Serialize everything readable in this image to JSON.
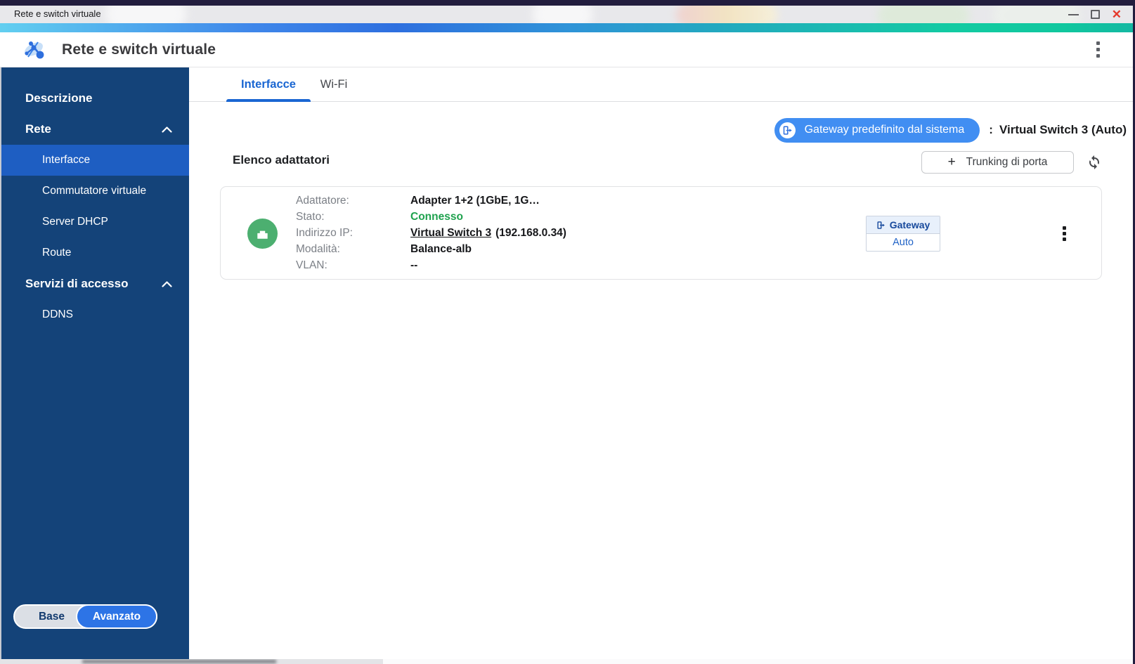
{
  "titlebar": {
    "title": "Rete e switch virtuale"
  },
  "header": {
    "title": "Rete e switch virtuale"
  },
  "sidebar": {
    "items": [
      {
        "label": "Descrizione",
        "type": "section",
        "selected": false
      },
      {
        "label": "Rete",
        "type": "section",
        "expanded": true,
        "selected": false
      },
      {
        "label": "Interfacce",
        "type": "child",
        "selected": true
      },
      {
        "label": "Commutatore virtuale",
        "type": "child",
        "selected": false
      },
      {
        "label": "Server DHCP",
        "type": "child",
        "selected": false
      },
      {
        "label": "Route",
        "type": "child",
        "selected": false
      },
      {
        "label": "Servizi di accesso",
        "type": "section",
        "expanded": true,
        "selected": false
      },
      {
        "label": "DDNS",
        "type": "child",
        "selected": false
      }
    ],
    "mode_toggle": {
      "base": "Base",
      "advanced": "Avanzato",
      "selected": "Avanzato"
    }
  },
  "main": {
    "tabs": [
      {
        "label": "Interfacce",
        "active": true
      },
      {
        "label": "Wi-Fi",
        "active": false
      }
    ],
    "default_gateway": {
      "button_label": "Gateway predefinito dal sistema",
      "separator": ":",
      "value": "Virtual Switch 3 (Auto)"
    },
    "adapter_list": {
      "heading": "Elenco adattatori",
      "trunking_button_label": "Trunking di porta",
      "adapters": [
        {
          "adapter_label": "Adattatore:",
          "adapter_value": "Adapter 1+2 (1GbE, 1G…",
          "status_label": "Stato:",
          "status_value": "Connesso",
          "ip_label": "Indirizzo IP:",
          "ip_link": "Virtual Switch 3",
          "ip_suffix": "(192.168.0.34)",
          "mode_label": "Modalità:",
          "mode_value": "Balance-alb",
          "vlan_label": "VLAN:",
          "vlan_value": "--",
          "badge": {
            "top": "Gateway",
            "bottom": "Auto"
          }
        }
      ]
    }
  },
  "icons": {
    "close": "✕",
    "plus": "+"
  },
  "colors": {
    "sidebar": "#144379",
    "sidebar_selected": "#1e5ec2",
    "accent_blue": "#1a66d2",
    "gateway_pill": "#418ef2",
    "status_connected": "#1fa24e",
    "gradient": [
      "#62cff0",
      "#2e6fdf",
      "#23a8c0",
      "#12cba2"
    ]
  }
}
